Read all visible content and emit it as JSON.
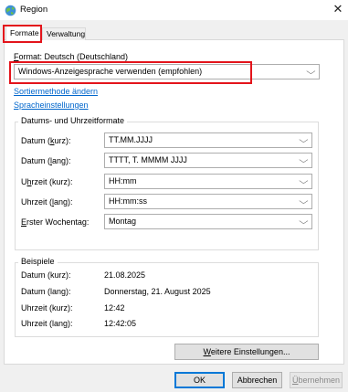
{
  "window": {
    "title": "Region",
    "icon": "globe-icon",
    "close_glyph": "✕"
  },
  "tabs": [
    {
      "label": "Formate",
      "active": true
    },
    {
      "label": "Verwaltung",
      "active": false
    }
  ],
  "format": {
    "label_pre": "F",
    "label_rest": "ormat: Deutsch (Deutschland)",
    "combo_value": "Windows-Anzeigesprache verwenden (empfohlen)"
  },
  "links": {
    "sort": "Sortiermethode ändern",
    "lang": "Spracheinstellungen"
  },
  "datetime": {
    "title": "Datums- und Uhrzeitformate",
    "rows": [
      {
        "pre": "Datum (",
        "key": "k",
        "post": "urz):",
        "value": "TT.MM.JJJJ"
      },
      {
        "pre": "Datum (",
        "key": "l",
        "post": "ang):",
        "value": "TTTT, T. MMMM JJJJ"
      },
      {
        "pre": "U",
        "key": "h",
        "post": "rzeit (kurz):",
        "value": "HH:mm"
      },
      {
        "pre": "Uhrzeit (",
        "key": "l",
        "post": "ang):",
        "value": "HH:mm:ss"
      },
      {
        "pre": "",
        "key": "E",
        "post": "rster Wochentag:",
        "value": "Montag"
      }
    ]
  },
  "examples": {
    "title": "Beispiele",
    "rows": [
      {
        "label": "Datum (kurz):",
        "value": "21.08.2025"
      },
      {
        "label": "Datum (lang):",
        "value": "Donnerstag, 21. August 2025"
      },
      {
        "label": "Uhrzeit (kurz):",
        "value": "12:42"
      },
      {
        "label": "Uhrzeit (lang):",
        "value": "12:42:05"
      }
    ]
  },
  "buttons": {
    "more_key": "W",
    "more_rest": "eitere Einstellungen...",
    "ok": "OK",
    "cancel": "Abbrechen",
    "apply_key": "Ü",
    "apply_rest": "bernehmen"
  },
  "colors": {
    "highlight": "#e3141b",
    "link": "#0066cc",
    "default_button_border": "#0078d7"
  }
}
